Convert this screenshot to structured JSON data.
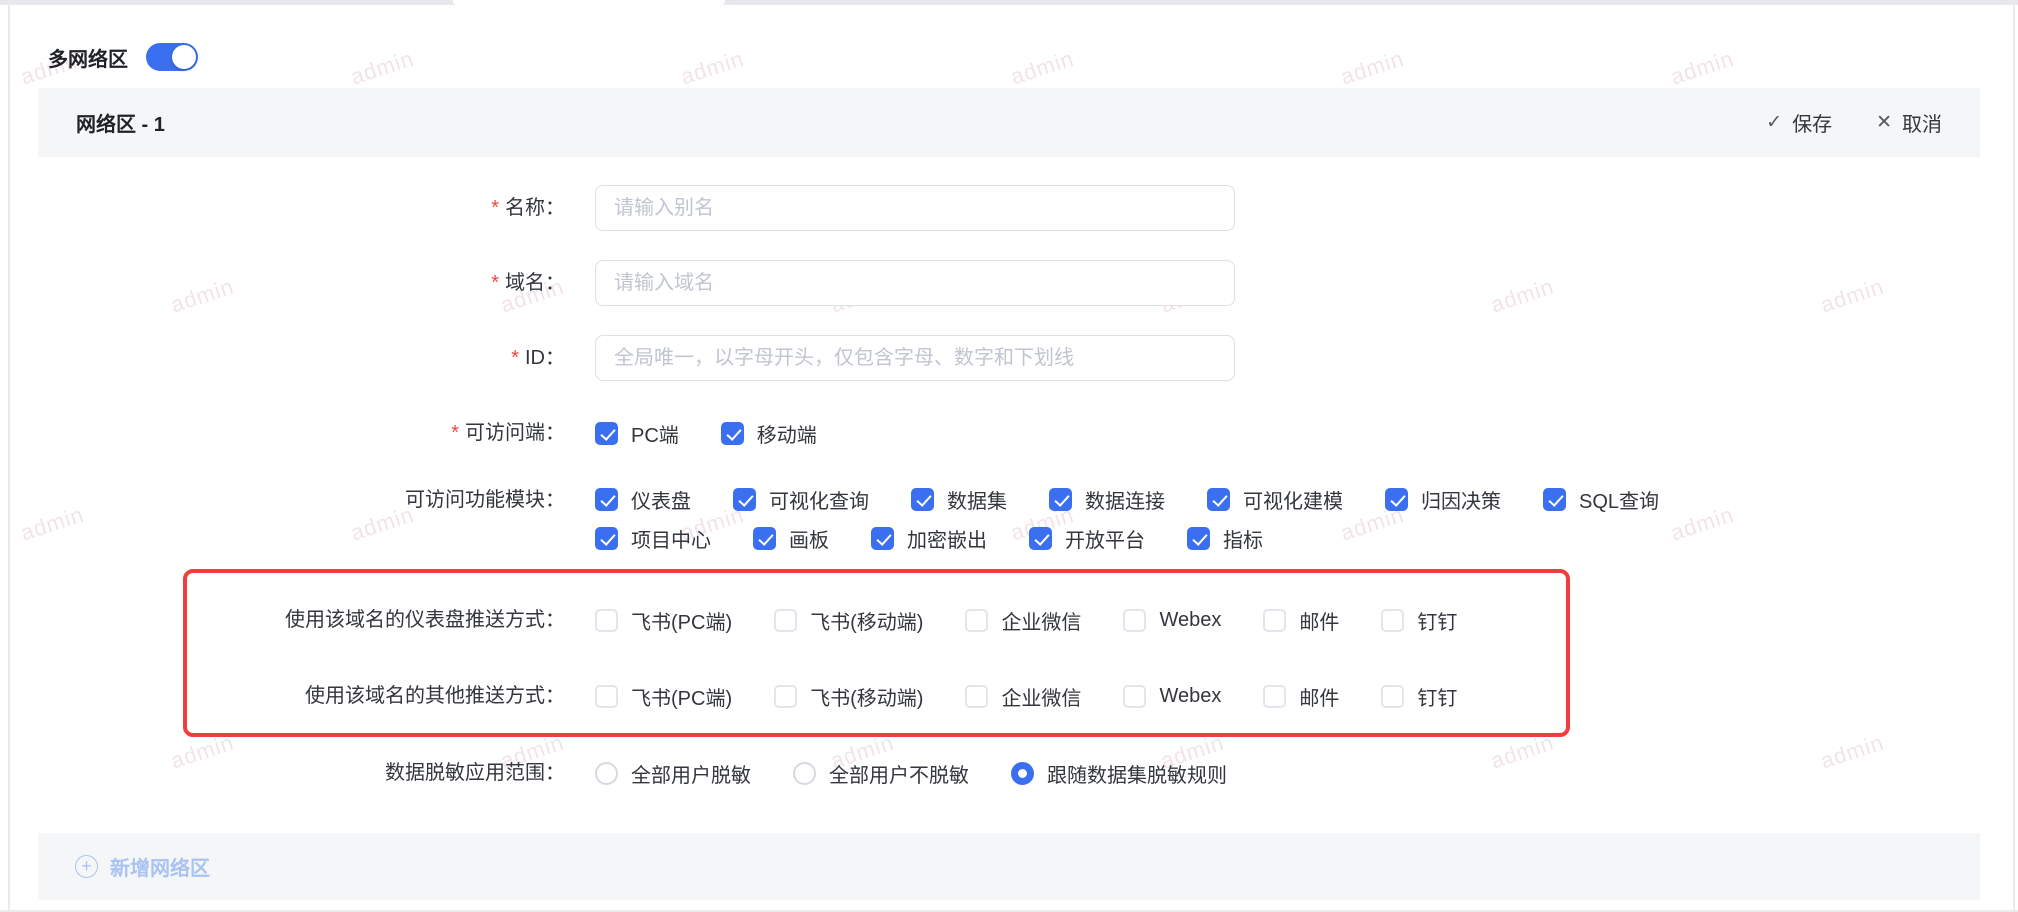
{
  "colors": {
    "accent": "#3a6ff0",
    "highlight_red": "#f23d3d"
  },
  "watermark": {
    "text": "admin"
  },
  "ui": {
    "required_mark": "*"
  },
  "icons": {
    "check": "✓",
    "close": "✕",
    "plus": "+"
  },
  "multi_zone": {
    "label": "多网络区",
    "enabled": true
  },
  "zone_panel": {
    "title": "网络区 - 1",
    "actions": {
      "save": "保存",
      "cancel": "取消"
    },
    "fields": {
      "name": {
        "label": "名称：",
        "required": true,
        "value": "",
        "placeholder": "请输入别名"
      },
      "domain": {
        "label": "域名：",
        "required": true,
        "value": "",
        "placeholder": "请输入域名"
      },
      "id": {
        "label": "ID：",
        "required": true,
        "value": "",
        "placeholder": "全局唯一，以字母开头，仅包含字母、数字和下划线"
      },
      "clients": {
        "label": "可访问端：",
        "required": true,
        "options": [
          {
            "label": "PC端",
            "checked": true
          },
          {
            "label": "移动端",
            "checked": true
          }
        ]
      },
      "modules": {
        "label": "可访问功能模块：",
        "options": [
          {
            "label": "仪表盘",
            "checked": true
          },
          {
            "label": "可视化查询",
            "checked": true
          },
          {
            "label": "数据集",
            "checked": true
          },
          {
            "label": "数据连接",
            "checked": true
          },
          {
            "label": "可视化建模",
            "checked": true
          },
          {
            "label": "归因决策",
            "checked": true
          },
          {
            "label": "SQL查询",
            "checked": true
          },
          {
            "label": "项目中心",
            "checked": true
          },
          {
            "label": "画板",
            "checked": true
          },
          {
            "label": "加密嵌出",
            "checked": true
          },
          {
            "label": "开放平台",
            "checked": true
          },
          {
            "label": "指标",
            "checked": true
          }
        ]
      },
      "dashboard_push": {
        "label": "使用该域名的仪表盘推送方式：",
        "options": [
          {
            "label": "飞书(PC端)",
            "checked": false
          },
          {
            "label": "飞书(移动端)",
            "checked": false
          },
          {
            "label": "企业微信",
            "checked": false
          },
          {
            "label": "Webex",
            "checked": false
          },
          {
            "label": "邮件",
            "checked": false
          },
          {
            "label": "钉钉",
            "checked": false
          }
        ]
      },
      "other_push": {
        "label": "使用该域名的其他推送方式：",
        "options": [
          {
            "label": "飞书(PC端)",
            "checked": false
          },
          {
            "label": "飞书(移动端)",
            "checked": false
          },
          {
            "label": "企业微信",
            "checked": false
          },
          {
            "label": "Webex",
            "checked": false
          },
          {
            "label": "邮件",
            "checked": false
          },
          {
            "label": "钉钉",
            "checked": false
          }
        ]
      },
      "masking": {
        "label": "数据脱敏应用范围：",
        "options": [
          {
            "label": "全部用户脱敏",
            "selected": false
          },
          {
            "label": "全部用户不脱敏",
            "selected": false
          },
          {
            "label": "跟随数据集脱敏规则",
            "selected": true
          }
        ]
      }
    }
  },
  "add_zone": {
    "label": "新增网络区"
  }
}
